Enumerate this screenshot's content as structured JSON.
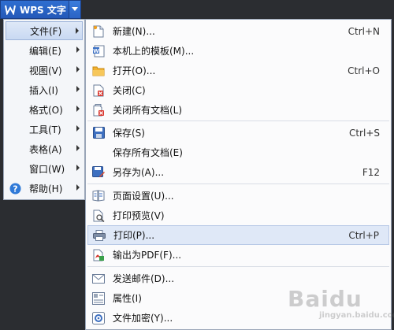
{
  "app": {
    "title": "WPS 文字"
  },
  "main_menu": {
    "items": [
      {
        "label": "文件(F)"
      },
      {
        "label": "编辑(E)"
      },
      {
        "label": "视图(V)"
      },
      {
        "label": "插入(I)"
      },
      {
        "label": "格式(O)"
      },
      {
        "label": "工具(T)"
      },
      {
        "label": "表格(A)"
      },
      {
        "label": "窗口(W)"
      },
      {
        "label": "帮助(H)"
      }
    ]
  },
  "file_menu": {
    "items": [
      {
        "label": "新建(N)...",
        "shortcut": "Ctrl+N",
        "icon": "new-document-icon"
      },
      {
        "label": "本机上的模板(M)...",
        "shortcut": "",
        "icon": "template-icon"
      },
      {
        "label": "打开(O)...",
        "shortcut": "Ctrl+O",
        "icon": "folder-open-icon"
      },
      {
        "label": "关闭(C)",
        "shortcut": "",
        "icon": "close-document-icon"
      },
      {
        "label": "关闭所有文档(L)",
        "shortcut": "",
        "icon": "close-all-documents-icon"
      },
      {
        "label": "保存(S)",
        "shortcut": "Ctrl+S",
        "icon": "save-icon"
      },
      {
        "label": "保存所有文档(E)",
        "shortcut": "",
        "icon": ""
      },
      {
        "label": "另存为(A)...",
        "shortcut": "F12",
        "icon": "save-as-icon"
      },
      {
        "label": "页面设置(U)...",
        "shortcut": "",
        "icon": "page-setup-icon"
      },
      {
        "label": "打印预览(V)",
        "shortcut": "",
        "icon": "print-preview-icon"
      },
      {
        "label": "打印(P)...",
        "shortcut": "Ctrl+P",
        "icon": "printer-icon"
      },
      {
        "label": "输出为PDF(F)...",
        "shortcut": "",
        "icon": "export-pdf-icon"
      },
      {
        "label": "发送邮件(D)...",
        "shortcut": "",
        "icon": "mail-icon"
      },
      {
        "label": "属性(I)",
        "shortcut": "",
        "icon": "properties-icon"
      },
      {
        "label": "文件加密(Y)...",
        "shortcut": "",
        "icon": "encrypt-icon"
      }
    ]
  },
  "watermark": {
    "text": "Baidu",
    "subtext": "jingyan.baidu.com"
  },
  "colors": {
    "accent": "#2a63c4",
    "hover": "#dfe8f7",
    "menu_bg": "#f4f6f9",
    "desktop": "#2b2d31"
  }
}
